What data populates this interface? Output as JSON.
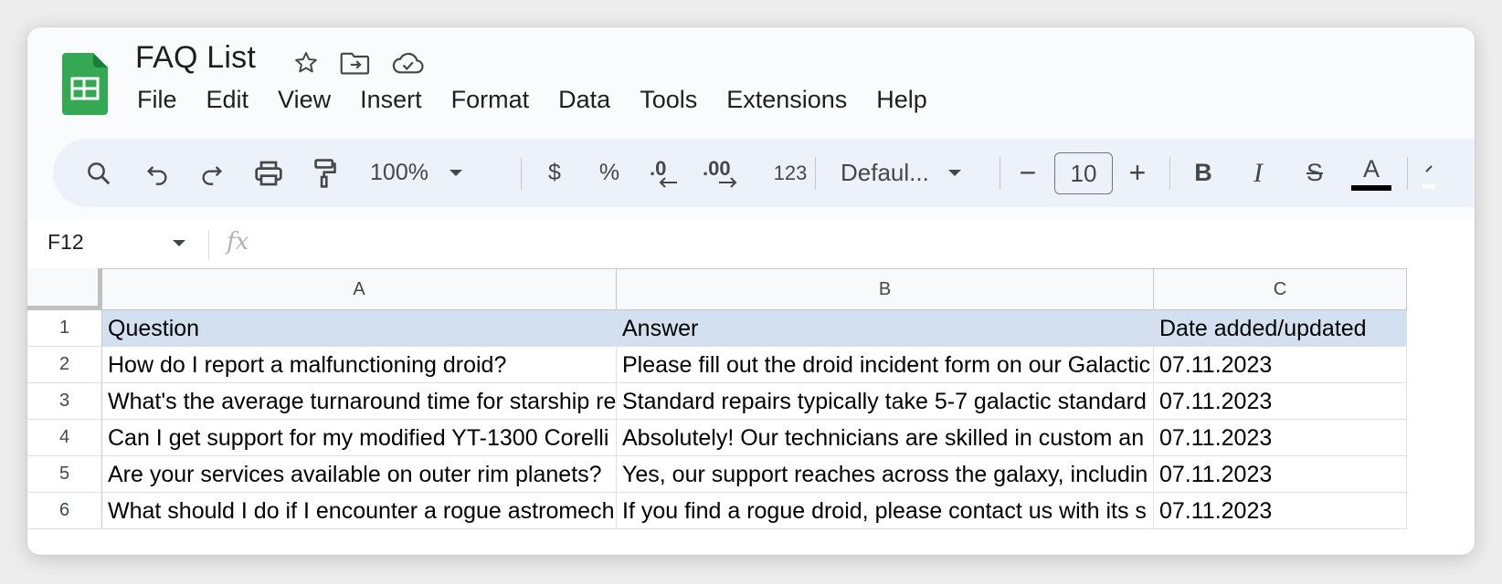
{
  "document": {
    "title": "FAQ List"
  },
  "title_icons": [
    "star-icon",
    "move-to-folder-icon",
    "cloud-saved-icon"
  ],
  "menu": [
    "File",
    "Edit",
    "View",
    "Insert",
    "Format",
    "Data",
    "Tools",
    "Extensions",
    "Help"
  ],
  "toolbar": {
    "zoom": "100%",
    "currency": "$",
    "percent": "%",
    "decrease_decimal": ".0",
    "increase_decimal": ".00",
    "number_format": "123",
    "font": "Defaul...",
    "font_size": "10",
    "minus": "−",
    "plus": "+",
    "bold": "B",
    "italic": "I",
    "strike": "S",
    "text_color": "A"
  },
  "formula_bar": {
    "cell_ref": "F12",
    "fx": "fx",
    "value": ""
  },
  "columns": [
    "A",
    "B",
    "C"
  ],
  "rows": [
    {
      "num": "1",
      "cells": [
        "Question",
        "Answer",
        "Date added/updated"
      ]
    },
    {
      "num": "2",
      "cells": [
        "How do I report a malfunctioning droid?",
        "Please fill out the droid incident form on our Galactic",
        "07.11.2023"
      ]
    },
    {
      "num": "3",
      "cells": [
        "What's the average turnaround time for starship re",
        "Standard repairs typically take 5-7 galactic standard",
        "07.11.2023"
      ]
    },
    {
      "num": "4",
      "cells": [
        "Can I get support for my modified YT-1300 Corelli",
        "Absolutely! Our technicians are skilled in custom an",
        "07.11.2023"
      ]
    },
    {
      "num": "5",
      "cells": [
        "Are your services available on outer rim planets?",
        "Yes, our support reaches across the galaxy, includin",
        "07.11.2023"
      ]
    },
    {
      "num": "6",
      "cells": [
        "What should I do if I encounter a rogue astromech",
        "If you find a rogue droid, please contact us with its s",
        "07.11.2023"
      ]
    }
  ],
  "colors": {
    "logo_green": "#34a853",
    "header_row_bg": "#d2e0f0",
    "toolbar_bg": "#edf2fa"
  }
}
